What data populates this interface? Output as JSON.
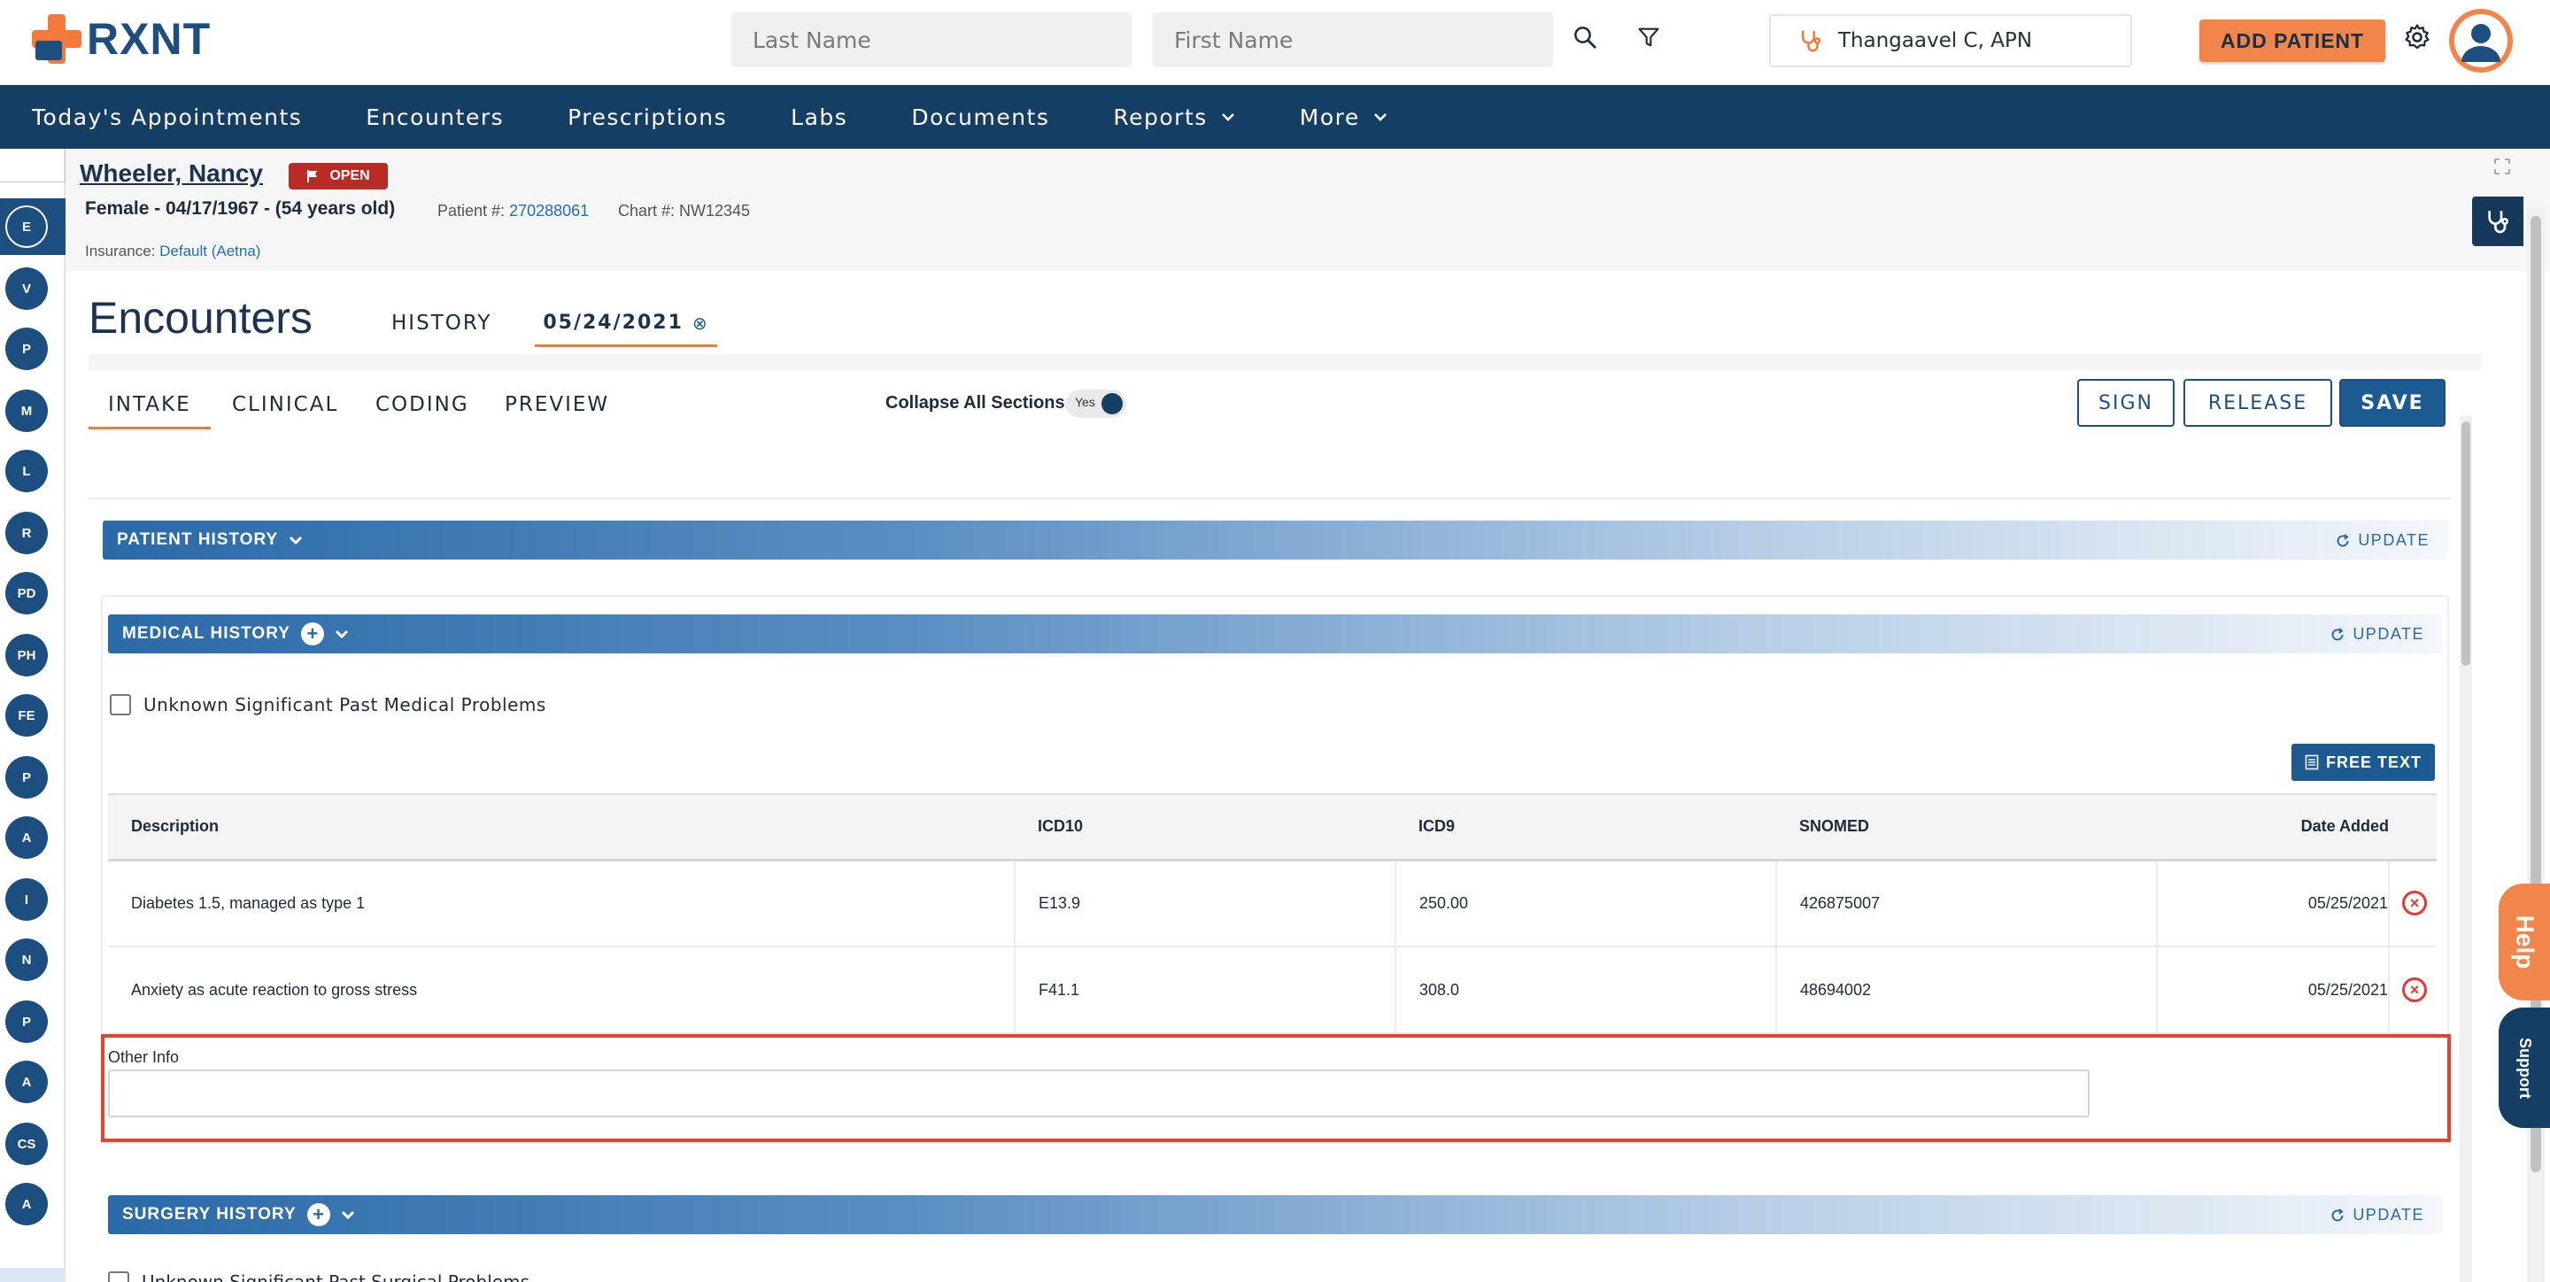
{
  "header": {
    "logo_text": "RXNT",
    "last_name_placeholder": "Last Name",
    "first_name_placeholder": "First Name",
    "provider_name": "Thangaavel C, APN",
    "add_patient_label": "ADD PATIENT",
    "brand_color": "#f27a3b",
    "primary_color": "#143e63"
  },
  "nav": {
    "items": [
      {
        "label": "Today's Appointments",
        "dropdown": false
      },
      {
        "label": "Encounters",
        "dropdown": false
      },
      {
        "label": "Prescriptions",
        "dropdown": false
      },
      {
        "label": "Labs",
        "dropdown": false
      },
      {
        "label": "Documents",
        "dropdown": false
      },
      {
        "label": "Reports",
        "dropdown": true
      },
      {
        "label": "More",
        "dropdown": true
      }
    ]
  },
  "left_rail": {
    "items": [
      "E",
      "V",
      "P",
      "M",
      "L",
      "R",
      "PD",
      "PH",
      "FE",
      "P",
      "A",
      "I",
      "N",
      "P",
      "A",
      "CS",
      "A"
    ]
  },
  "patient": {
    "name": "Wheeler, Nancy",
    "status": "OPEN",
    "demographics": "Female - 04/17/1967 - (54 years old)",
    "patient_number_label": "Patient #:",
    "patient_number": "270288061",
    "chart_label": "Chart #: NW12345",
    "insurance_label": "Insurance:",
    "insurance_value": "Default (Aetna)"
  },
  "encounter": {
    "title": "Encounters",
    "history_tab": "HISTORY",
    "date_tab": "05/24/2021",
    "date_tab_close": "⊗",
    "sub_tabs": [
      "INTAKE",
      "CLINICAL",
      "CODING",
      "PREVIEW"
    ],
    "collapse_label": "Collapse All Sections:",
    "collapse_value": "Yes",
    "sign_label": "SIGN",
    "release_label": "RELEASE",
    "save_label": "SAVE"
  },
  "sections": {
    "patient_history": {
      "label": "PATIENT HISTORY",
      "update": "UPDATE"
    },
    "medical_history": {
      "label": "MEDICAL HISTORY",
      "update": "UPDATE",
      "unknown_checkbox": "Unknown Significant Past Medical Problems",
      "free_text_label": "FREE TEXT",
      "columns": [
        "Description",
        "ICD10",
        "ICD9",
        "SNOMED",
        "Date Added"
      ],
      "rows": [
        {
          "description": "Diabetes 1.5, managed as type 1",
          "icd10": "E13.9",
          "icd9": "250.00",
          "snomed": "426875007",
          "date_added": "05/25/2021"
        },
        {
          "description": "Anxiety as acute reaction to gross stress",
          "icd10": "F41.1",
          "icd9": "308.0",
          "snomed": "48694002",
          "date_added": "05/25/2021"
        }
      ],
      "other_info_label": "Other Info",
      "other_info_value": ""
    },
    "surgery_history": {
      "label": "SURGERY HISTORY",
      "update": "UPDATE",
      "unknown_checkbox": "Unknown Significant Past Surgical Problems"
    }
  },
  "floating": {
    "help_label": "Help",
    "support_label": "Support"
  }
}
